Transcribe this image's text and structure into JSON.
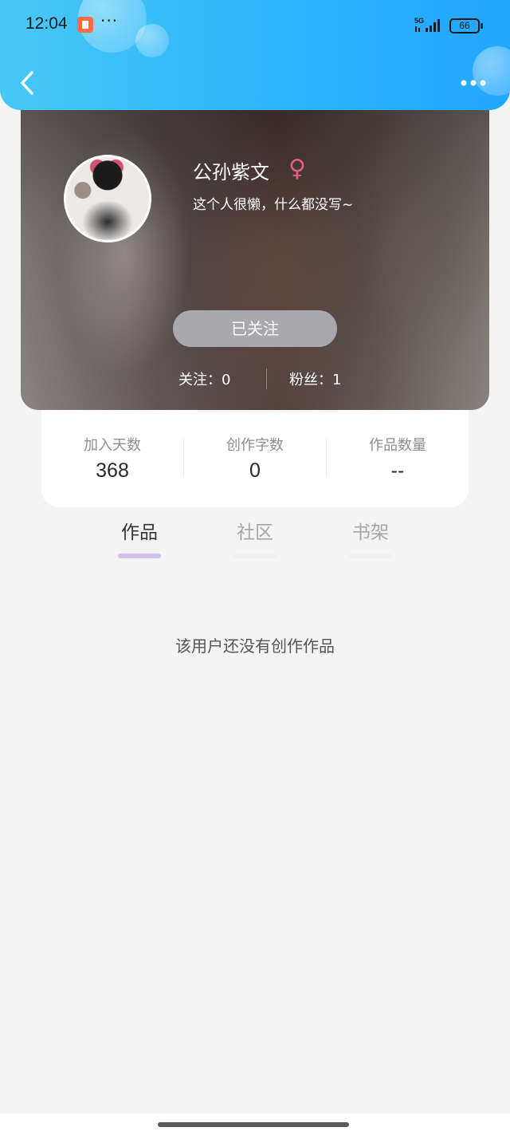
{
  "status_bar": {
    "time": "12:04",
    "more": "···",
    "network": "5G",
    "battery": "66"
  },
  "nav": {
    "back_icon": "chevron-left-icon",
    "more_icon": "more-dots-icon"
  },
  "profile": {
    "username": "公孙紫文",
    "gender_symbol": "♀",
    "bio": "这个人很懒，什么都没写~",
    "follow_button": "已关注",
    "following": "关注：0",
    "fans": "粉丝：1",
    "gender_color": "#e15c86"
  },
  "stats": [
    {
      "label": "加入天数",
      "value": "368"
    },
    {
      "label": "创作字数",
      "value": "0"
    },
    {
      "label": "作品数量",
      "value": "--"
    }
  ],
  "tabs": [
    {
      "label": "作品",
      "active": true
    },
    {
      "label": "社区",
      "active": false
    },
    {
      "label": "书架",
      "active": false
    }
  ],
  "empty_message": "该用户还没有创作作品",
  "colors": {
    "header_start": "#47c8f5",
    "header_end": "#23a6ff",
    "tab_accent": "#d7bff0"
  }
}
